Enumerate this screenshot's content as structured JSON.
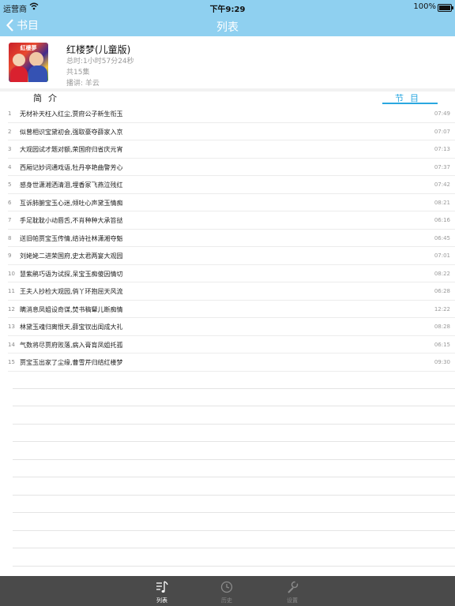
{
  "status": {
    "carrier": "运营商",
    "time": "下午9:29",
    "battery": "100%",
    "battery_level": 1.0
  },
  "nav": {
    "back_label": "书目",
    "title": "列表"
  },
  "book": {
    "cover_text": "紅樓夢",
    "title": "红楼梦(儿童版)",
    "duration": "总时:1小时57分24秒",
    "episodes": "共15集",
    "narrator": "播讲: 羊云"
  },
  "tabs": {
    "intro": "简介",
    "episodes": "节目"
  },
  "episodes": [
    {
      "num": "1",
      "title": "无材补天枉入红尘,贾府公子新生衔玉",
      "duration": "07:49"
    },
    {
      "num": "2",
      "title": "似曾相识宝黛初会,强取豪夺薛家入京",
      "duration": "07:07"
    },
    {
      "num": "3",
      "title": "大观园试才题对额,荣国府归省庆元宵",
      "duration": "07:13"
    },
    {
      "num": "4",
      "title": "西厢记妙词通戏语,牡丹亭艳曲警芳心",
      "duration": "07:37"
    },
    {
      "num": "5",
      "title": "感身世潇湘洒清泪,埋香冢飞燕泣残红",
      "duration": "07:42"
    },
    {
      "num": "6",
      "title": "互诉肺腑宝玉心迷,倾吐心声黛玉情痴",
      "duration": "08:21"
    },
    {
      "num": "7",
      "title": "手足耽耽小动唇舌,不肖种种大承笞挞",
      "duration": "06:16"
    },
    {
      "num": "8",
      "title": "送旧帕贾宝玉传情,结诗社林潇湘夺魁",
      "duration": "06:45"
    },
    {
      "num": "9",
      "title": "刘姥姥二进荣国府,史太君两宴大观园",
      "duration": "07:01"
    },
    {
      "num": "10",
      "title": "慧紫鹃巧语为试探,呆宝玉痴傻因情切",
      "duration": "08:22"
    },
    {
      "num": "11",
      "title": "王夫人抄检大观园,俏丫环抱屈天风流",
      "duration": "06:28"
    },
    {
      "num": "12",
      "title": "瞒消息凤姐设奇谋,焚书稿颦儿断痴情",
      "duration": "12:22"
    },
    {
      "num": "13",
      "title": "林黛玉魂归离恨天,薛宝钗出闺成大礼",
      "duration": "08:28"
    },
    {
      "num": "14",
      "title": "气数将尽贾府败落,病入膏肓凤姐托孤",
      "duration": "06:15"
    },
    {
      "num": "15",
      "title": "贾宝玉出家了尘缘,曹雪芹归结红楼梦",
      "duration": "09:30"
    }
  ],
  "tabbar": {
    "list": "列表",
    "history": "历史",
    "settings": "设置"
  },
  "colors": {
    "nav_bg": "#8fd0f0",
    "accent": "#2aa7e0",
    "tabbar_bg": "#4a4a4a"
  }
}
